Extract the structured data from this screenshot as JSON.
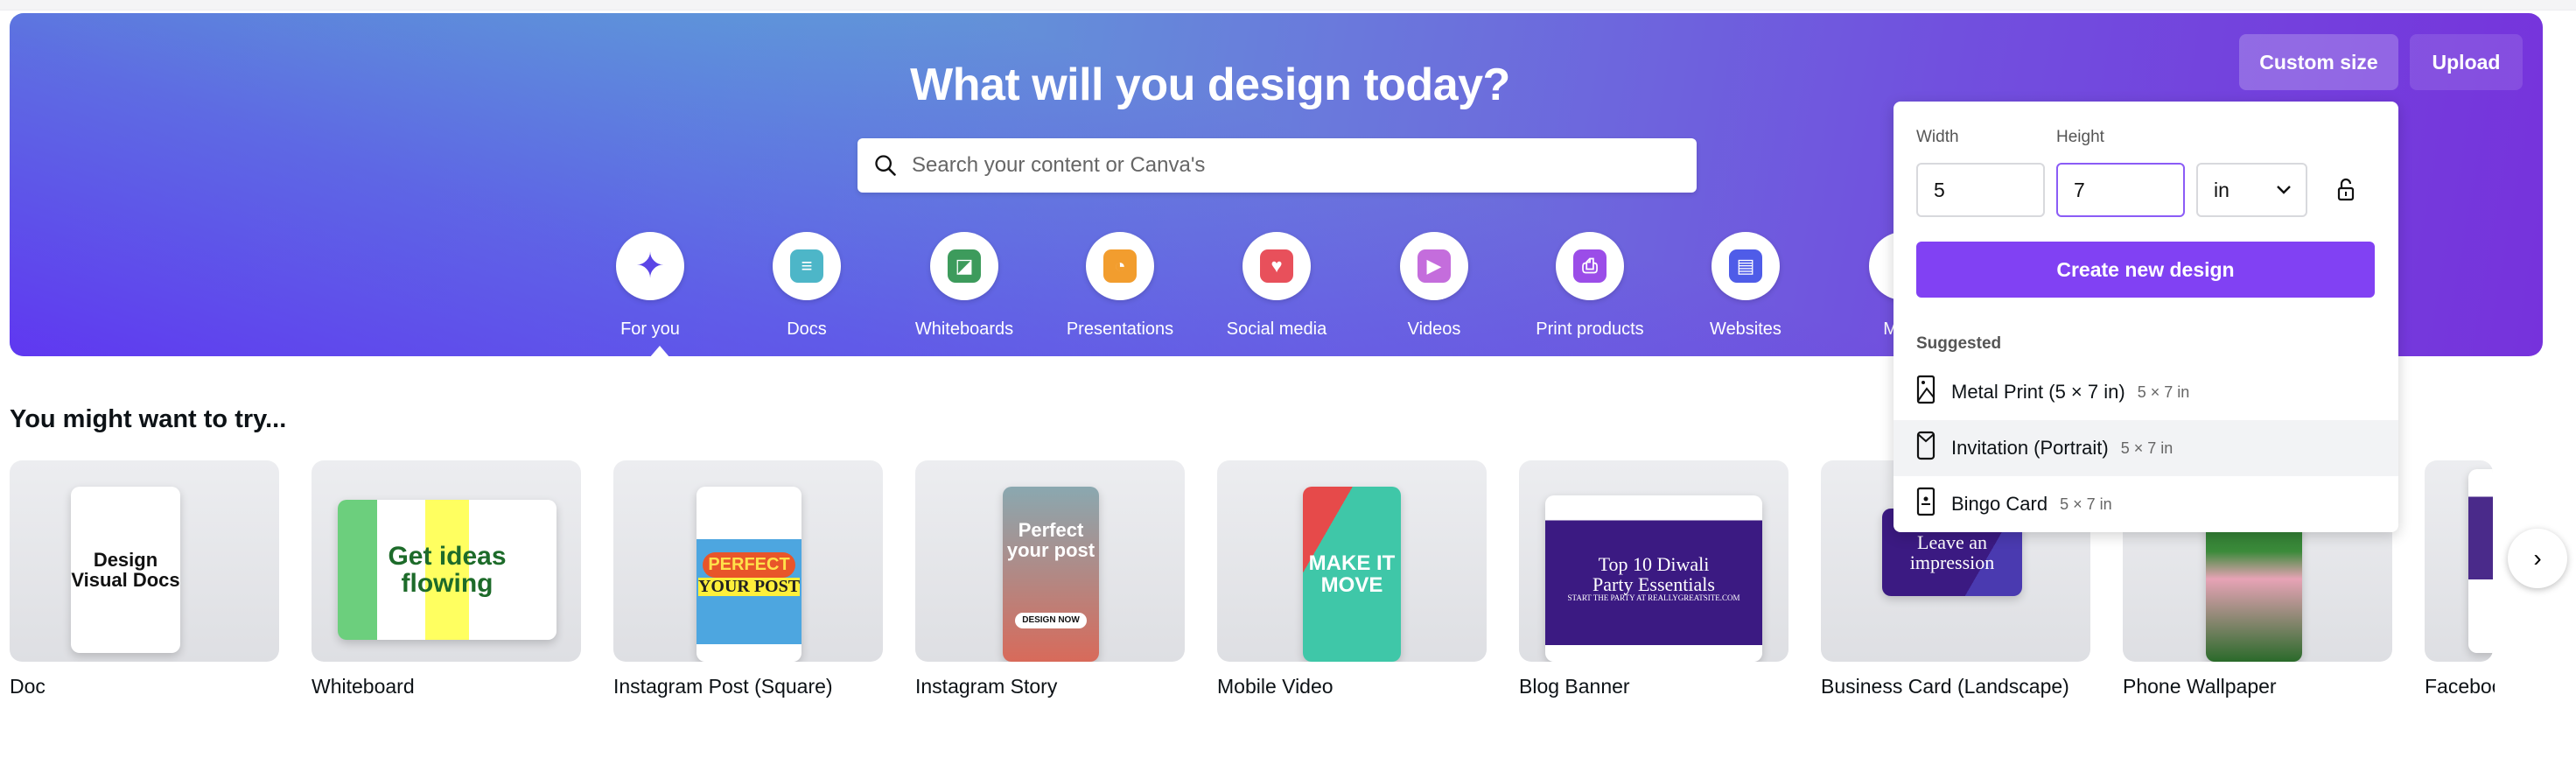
{
  "header": {
    "title": "What will you design today?",
    "search_placeholder": "Search your content or Canva's",
    "custom_size": "Custom size",
    "upload": "Upload"
  },
  "categories": [
    {
      "label": "For you",
      "icon": "sparkle-icon",
      "color": "#5b45e6"
    },
    {
      "label": "Docs",
      "icon": "doc-icon",
      "color": "#4db6c8"
    },
    {
      "label": "Whiteboards",
      "icon": "whiteboard-icon",
      "color": "#3d9b5c"
    },
    {
      "label": "Presentations",
      "icon": "presentation-icon",
      "color": "#f29d2e"
    },
    {
      "label": "Social media",
      "icon": "heart-icon",
      "color": "#e8505b"
    },
    {
      "label": "Videos",
      "icon": "video-icon",
      "color": "#c46ddc"
    },
    {
      "label": "Print products",
      "icon": "printer-icon",
      "color": "#9b4de8"
    },
    {
      "label": "Websites",
      "icon": "website-icon",
      "color": "#4f5ce8"
    },
    {
      "label": "More",
      "icon": "more-icon",
      "color": "#5b45e6"
    }
  ],
  "section_title": "You might want to try...",
  "cards": [
    {
      "label": "Doc",
      "thumb": [
        "Design",
        "Visual Docs"
      ]
    },
    {
      "label": "Whiteboard",
      "thumb": [
        "Get ideas",
        "flowing"
      ]
    },
    {
      "label": "Instagram Post (Square)",
      "thumb": [
        "PERFECT",
        "YOUR POST"
      ]
    },
    {
      "label": "Instagram Story",
      "thumb": [
        "Perfect your post",
        "DESIGN NOW"
      ]
    },
    {
      "label": "Mobile Video",
      "thumb": [
        "MAKE IT",
        "MOVE"
      ]
    },
    {
      "label": "Blog Banner",
      "thumb": [
        "Top 10 Diwali",
        "Party Essentials",
        "START THE PARTY AT REALLYGREATSITE.COM"
      ]
    },
    {
      "label": "Business Card (Landscape)",
      "thumb": [
        "Leave an",
        "impression"
      ]
    },
    {
      "label": "Phone Wallpaper",
      "thumb": []
    },
    {
      "label": "Facebook Post",
      "thumb": []
    }
  ],
  "custom_size_panel": {
    "width_label": "Width",
    "height_label": "Height",
    "width_value": "5",
    "height_value": "7",
    "unit": "in",
    "lock_icon": "unlock-icon",
    "create_button": "Create new design",
    "suggested_label": "Suggested",
    "accent": "#8141f3",
    "suggestions": [
      {
        "name": "Metal Print (5 × 7 in)",
        "size": "5 × 7 in",
        "icon": "image-frame-icon"
      },
      {
        "name": "Invitation (Portrait)",
        "size": "5 × 7 in",
        "icon": "invitation-icon",
        "highlighted": true
      },
      {
        "name": "Bingo Card",
        "size": "5 × 7 in",
        "icon": "card-icon"
      }
    ]
  }
}
